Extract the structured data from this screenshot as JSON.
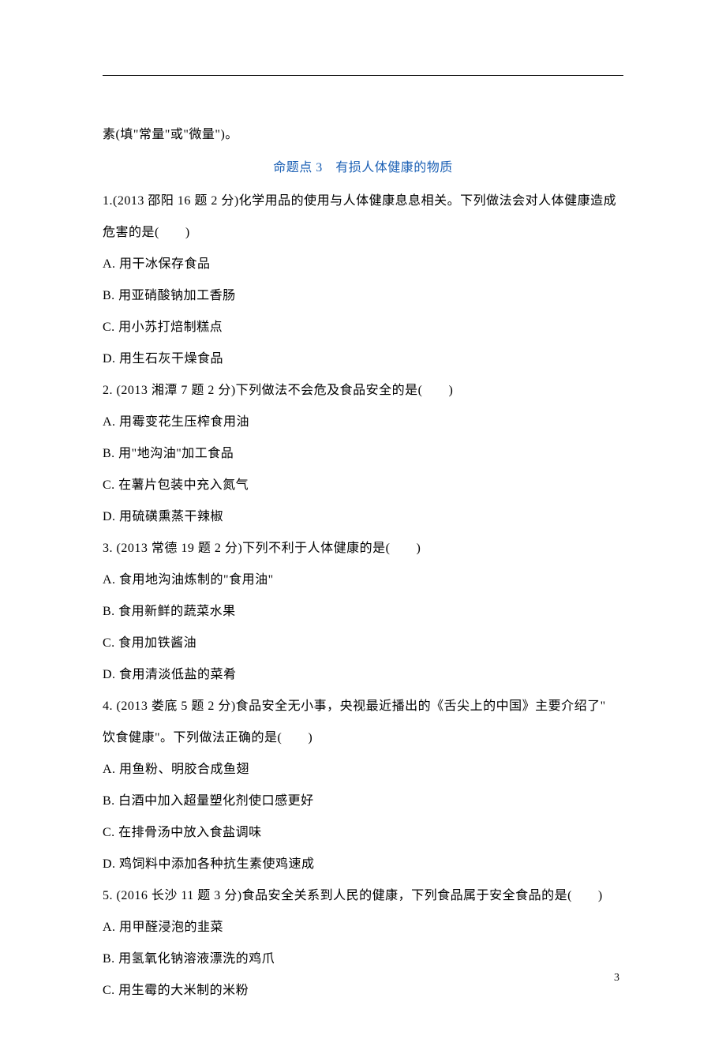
{
  "continuation_line": "素(填\"常量\"或\"微量\")。",
  "section_heading": "命题点 3　有损人体健康的物质",
  "questions": [
    {
      "stem_lines": [
        "1.(2013 邵阳 16 题 2 分)化学用品的使用与人体健康息息相关。下列做法会对人体健康造成",
        "危害的是(　　)"
      ],
      "options": [
        "A. 用干冰保存食品",
        "B. 用亚硝酸钠加工香肠",
        "C. 用小苏打焙制糕点",
        "D. 用生石灰干燥食品"
      ]
    },
    {
      "stem_lines": [
        "2. (2013 湘潭 7 题 2 分)下列做法不会危及食品安全的是(　　)"
      ],
      "options": [
        "A. 用霉变花生压榨食用油",
        "B. 用\"地沟油\"加工食品",
        "C. 在薯片包装中充入氮气",
        "D. 用硫磺熏蒸干辣椒"
      ]
    },
    {
      "stem_lines": [
        "3. (2013 常德 19 题 2 分)下列不利于人体健康的是(　　)"
      ],
      "options": [
        "A. 食用地沟油炼制的\"食用油\"",
        "B. 食用新鲜的蔬菜水果",
        "C. 食用加铁酱油",
        "D. 食用清淡低盐的菜肴"
      ]
    },
    {
      "stem_lines": [
        "4. (2013 娄底 5 题 2 分)食品安全无小事，央视最近播出的《舌尖上的中国》主要介绍了\"",
        "饮食健康\"。下列做法正确的是(　　)"
      ],
      "options": [
        "A. 用鱼粉、明胶合成鱼翅",
        "B. 白酒中加入超量塑化剂使口感更好",
        "C. 在排骨汤中放入食盐调味",
        "D. 鸡饲料中添加各种抗生素使鸡速成"
      ]
    },
    {
      "stem_lines": [
        "5. (2016 长沙 11 题 3 分)食品安全关系到人民的健康，下列食品属于安全食品的是(　　)"
      ],
      "options": [
        "A. 用甲醛浸泡的韭菜",
        "B. 用氢氧化钠溶液漂洗的鸡爪",
        "C. 用生霉的大米制的米粉"
      ]
    }
  ],
  "page_number": "3"
}
